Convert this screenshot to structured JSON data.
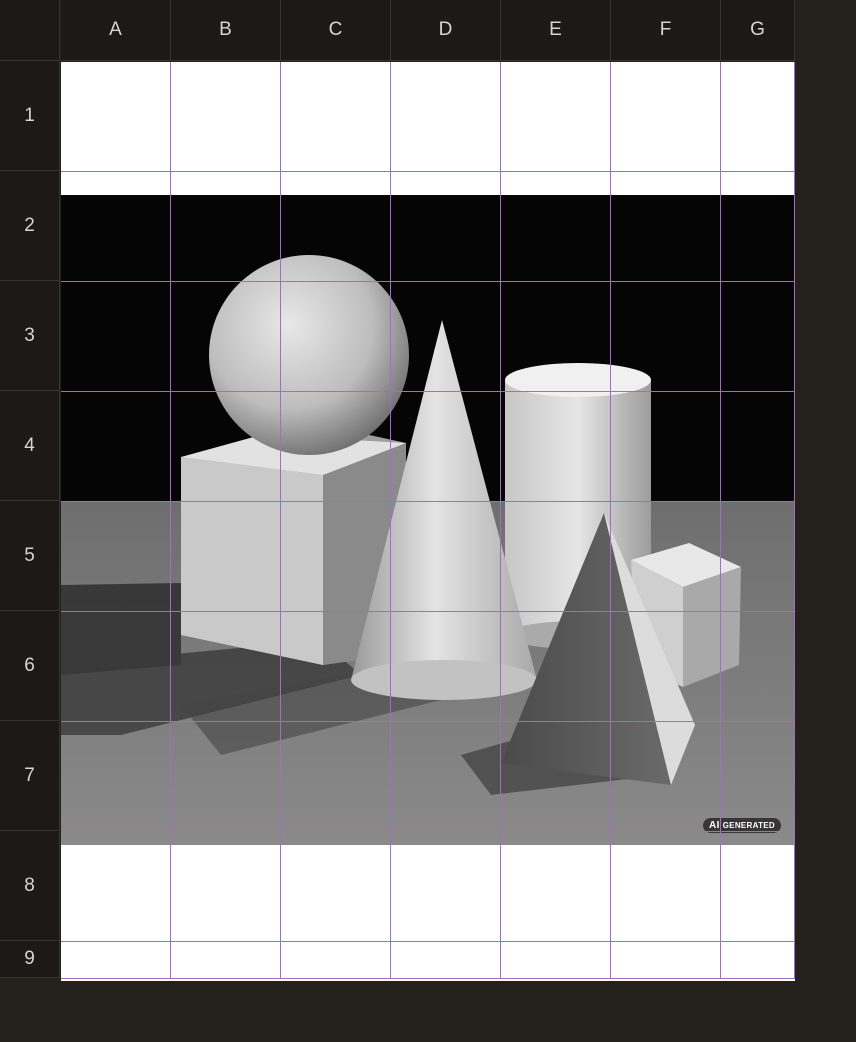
{
  "columns": [
    "A",
    "B",
    "C",
    "D",
    "E",
    "F",
    "G"
  ],
  "rows": [
    "1",
    "2",
    "3",
    "4",
    "5",
    "6",
    "7",
    "8",
    "9"
  ],
  "image": {
    "description_icon": "image-icon",
    "badge": {
      "prefix": "AI",
      "label": "GENERATED"
    }
  },
  "colors": {
    "gridline": "#a26dc4",
    "header_bg": "#1c1916",
    "app_bg": "#24201c"
  }
}
